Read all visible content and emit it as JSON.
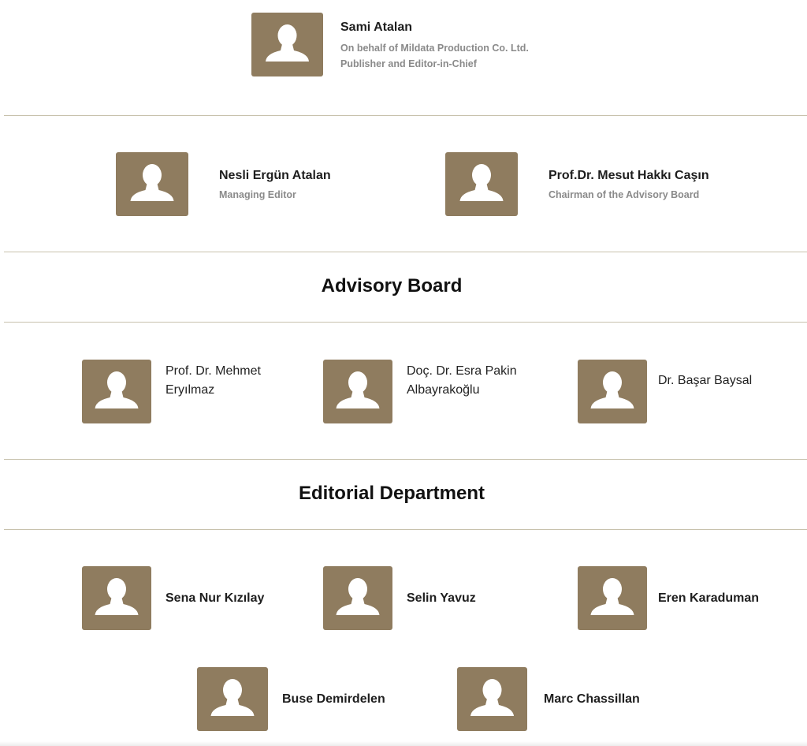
{
  "top_person": {
    "name": "Sami Atalan",
    "role_line1": "On behalf of Mildata Production Co. Ltd.",
    "role_line2": "Publisher and Editor-in-Chief"
  },
  "editors": [
    {
      "name": "Nesli Ergün Atalan",
      "role": "Managing Editor"
    },
    {
      "name": "Prof.Dr. Mesut Hakkı Caşın",
      "role": "Chairman of the Advisory Board"
    }
  ],
  "advisory_board": {
    "title": "Advisory Board",
    "members": [
      {
        "name_line1": "Prof. Dr. Mehmet",
        "name_line2": "Eryılmaz"
      },
      {
        "name_line1": "Doç. Dr. Esra Pakin",
        "name_line2": "Albayrakoğlu"
      },
      {
        "name_line1": "Dr. Başar Baysal",
        "name_line2": ""
      }
    ]
  },
  "editorial_department": {
    "title": "Editorial Department",
    "members": [
      {
        "name": "Sena Nur Kızılay"
      },
      {
        "name": "Selin Yavuz"
      },
      {
        "name": "Eren Karaduman"
      },
      {
        "name": "Buse Demirdelen"
      },
      {
        "name": "Marc Chassillan"
      }
    ]
  },
  "icon": "person-silhouette-icon",
  "colors": {
    "avatar_bg": "#8f7c5f",
    "divider": "#c8c2ad",
    "role_text": "#8a8a8a"
  }
}
